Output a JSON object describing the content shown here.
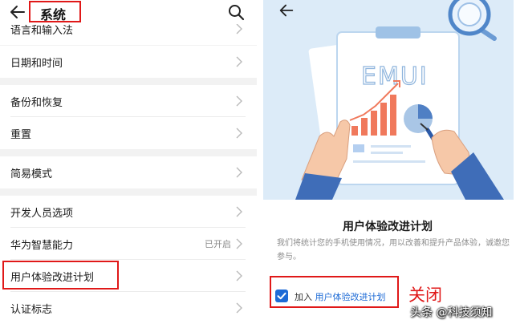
{
  "left_screen": {
    "title": "系统",
    "items": [
      {
        "label": "语言和输入法"
      },
      {
        "label": "日期和时间"
      },
      {
        "label": "备份和恢复"
      },
      {
        "label": "重置"
      },
      {
        "label": "简易模式"
      },
      {
        "label": "开发人员选项"
      },
      {
        "label": "华为智慧能力",
        "value": "已开启"
      },
      {
        "label": "用户体验改进计划"
      },
      {
        "label": "认证标志"
      }
    ]
  },
  "right_screen": {
    "illustration_text": "EMUI",
    "plan_title": "用户体验改进计划",
    "plan_description": "我们将统计您的手机使用情况，用以改善和提升产品体验，诚邀您参与。",
    "join_prefix": "加入",
    "join_link": "用户体验改进计划",
    "join_checked": true
  },
  "annotation": {
    "close_note": "关闭",
    "watermark": "头条 @科技须知"
  },
  "colors": {
    "highlight_red": "#e01818",
    "accent_blue": "#1e6bd6",
    "hero_bg": "#dcebf8"
  },
  "icons": [
    "back-arrow-icon",
    "search-icon",
    "chevron-right-icon",
    "checkbox-checked-icon",
    "magnifier-icon"
  ]
}
